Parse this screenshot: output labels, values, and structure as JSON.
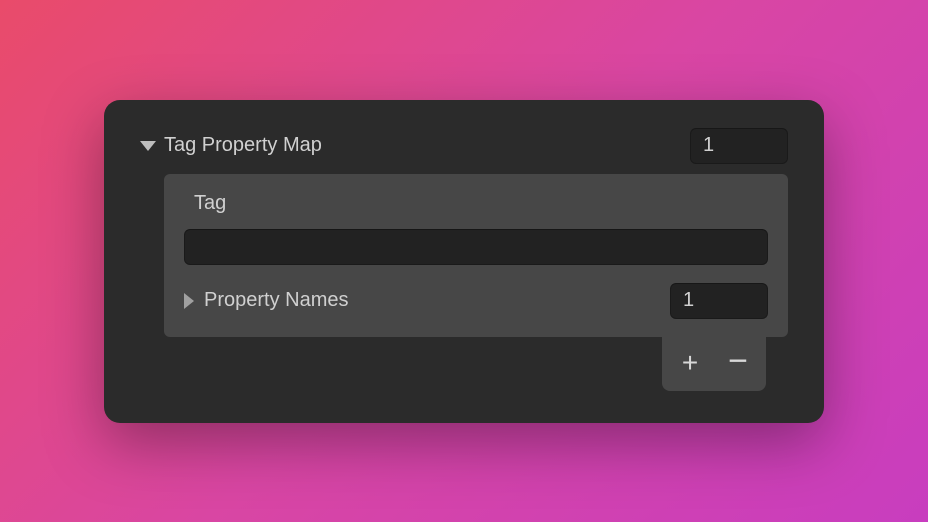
{
  "header": {
    "title": "Tag Property Map",
    "count": "1"
  },
  "tag": {
    "label": "Tag",
    "value": ""
  },
  "propertyNames": {
    "label": "Property Names",
    "count": "1"
  },
  "buttons": {
    "add": "+",
    "remove": "−"
  }
}
